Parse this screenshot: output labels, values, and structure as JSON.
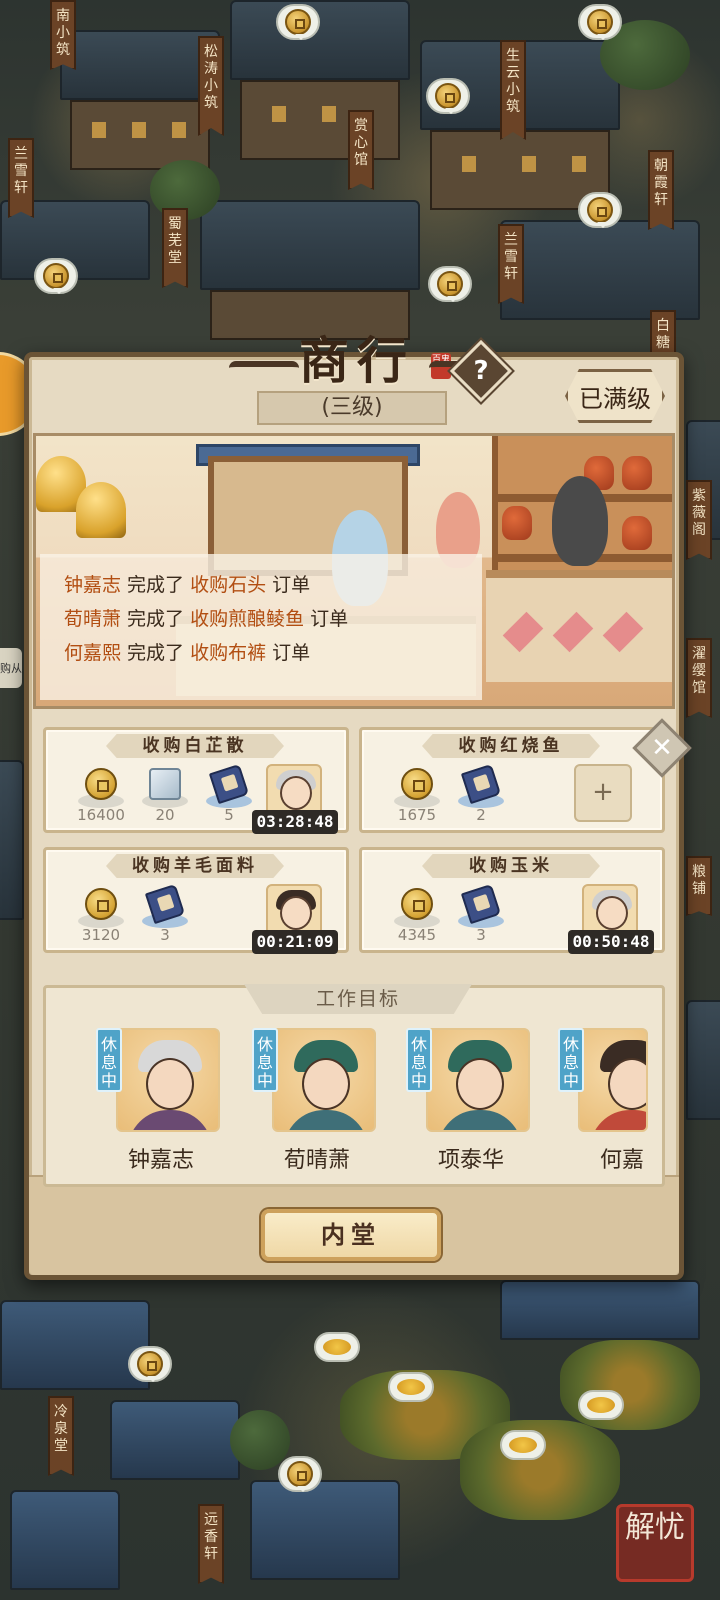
{
  "map": {
    "labels_top": [
      "南小筑",
      "松涛小筑",
      "赏心馆",
      "生云小筑",
      "兰雪轩",
      "蜀芜堂",
      "兰雪轩",
      "朝霞轩",
      "白糖"
    ],
    "labels_right": [
      "紫薇阁",
      "濯缨馆",
      "粮铺"
    ],
    "labels_bottom": [
      "冷泉堂",
      "远香轩"
    ],
    "watermark": "解忧",
    "left_tag": "购从"
  },
  "panel": {
    "title": "商行",
    "title_seal": "百鬼",
    "help_icon": "?",
    "level": "(三级)",
    "max_badge": "已满级",
    "feed": [
      {
        "name": "钟嘉志",
        "verb": " 完成了 ",
        "item": "收购石头",
        "suffix": " 订单"
      },
      {
        "name": "荀晴萧",
        "verb": " 完成了 ",
        "item": "收购煎酿鲮鱼",
        "suffix": " 订单"
      },
      {
        "name": "何嘉熙",
        "verb": " 完成了 ",
        "item": "收购布裤",
        "suffix": " 订单"
      }
    ]
  },
  "orders": [
    {
      "title": "收购白芷散",
      "costs": [
        "16400",
        "20",
        "5"
      ],
      "timer": "03:28:48"
    },
    {
      "title": "收购红烧鱼",
      "costs": [
        "1675",
        "2"
      ],
      "add": "+"
    },
    {
      "title": "收购羊毛面料",
      "costs": [
        "3120",
        "3"
      ],
      "timer": "00:21:09"
    },
    {
      "title": "收购玉米",
      "costs": [
        "4345",
        "3"
      ],
      "timer": "00:50:48"
    }
  ],
  "close_icon": "✕",
  "work": {
    "title": "工作目标",
    "rest_label": "休息中",
    "members": [
      "钟嘉志",
      "荀晴萧",
      "项泰华",
      "何嘉"
    ]
  },
  "inner_button": "内堂",
  "colors": {
    "accent": "#b24e12",
    "rest": "#4fa3c8",
    "panel": "#e6dac2"
  }
}
